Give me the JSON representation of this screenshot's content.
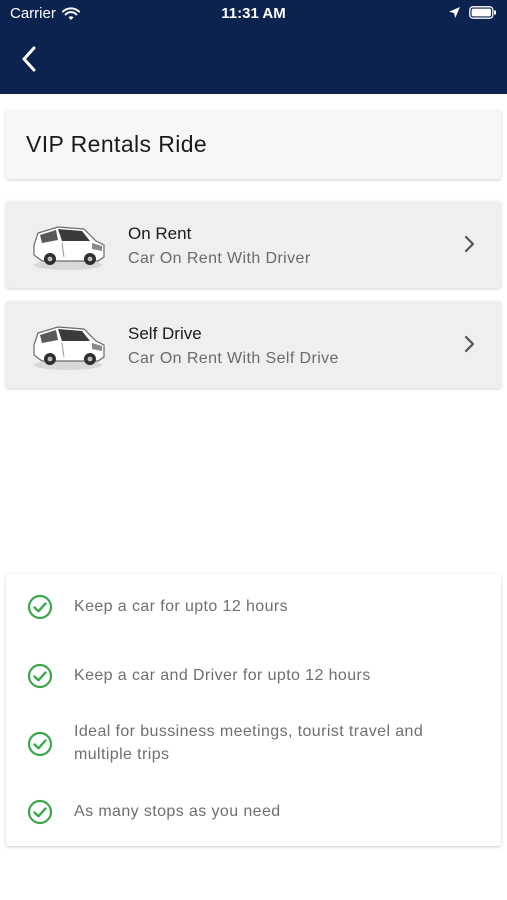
{
  "status_bar": {
    "carrier": "Carrier",
    "time": "11:31 AM"
  },
  "header": {
    "back_icon": "chevron-left-icon"
  },
  "title": "VIP Rentals Ride",
  "options": [
    {
      "title": "On Rent",
      "subtitle": "Car On Rent With Driver",
      "icon": "car-icon"
    },
    {
      "title": "Self Drive",
      "subtitle": "Car On Rent With Self Drive",
      "icon": "car-icon"
    }
  ],
  "features": [
    {
      "text": "Keep a car for upto 12 hours",
      "icon": "check-circle-icon"
    },
    {
      "text": "Keep a car and Driver for upto 12 hours",
      "icon": "check-circle-icon"
    },
    {
      "text": "Ideal for bussiness meetings, tourist travel and multiple trips",
      "icon": "check-circle-icon"
    },
    {
      "text": "As many stops as you need",
      "icon": "check-circle-icon"
    }
  ],
  "colors": {
    "header_bg": "#0c2350",
    "check_green": "#3aa84a"
  }
}
